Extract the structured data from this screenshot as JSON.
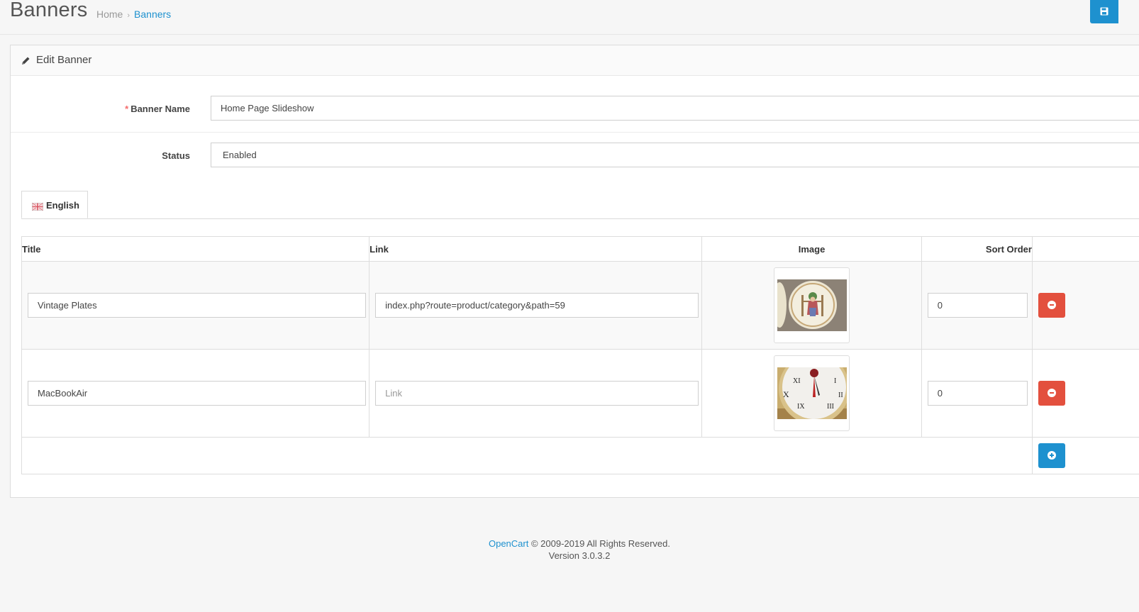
{
  "header": {
    "title": "Banners",
    "breadcrumb": {
      "home": "Home",
      "separator": "›",
      "current": "Banners"
    }
  },
  "panel": {
    "heading": "Edit Banner",
    "banner_name": {
      "label": "Banner Name",
      "required_mark": "*",
      "value": "Home Page Slideshow"
    },
    "status": {
      "label": "Status",
      "value": "Enabled"
    },
    "tab": {
      "label": "English",
      "icon": "uk-flag-icon"
    }
  },
  "table": {
    "headers": {
      "title": "Title",
      "link": "Link",
      "image": "Image",
      "sort_order": "Sort Order"
    },
    "rows": [
      {
        "title": "Vintage Plates",
        "link": "index.php?route=product/category&path=59",
        "link_placeholder": "Link",
        "image": "vintage-plates-thumbnail",
        "sort_order": "0"
      },
      {
        "title": "MacBookAir",
        "link": "",
        "link_placeholder": "Link",
        "image": "clock-thumbnail",
        "sort_order": "0"
      }
    ]
  },
  "footer": {
    "brand": "OpenCart",
    "copyright": "© 2009-2019 All Rights Reserved.",
    "version": "Version 3.0.3.2"
  },
  "colors": {
    "primary": "#1e91cf",
    "danger": "#e3503e",
    "required": "#f56b6b"
  }
}
